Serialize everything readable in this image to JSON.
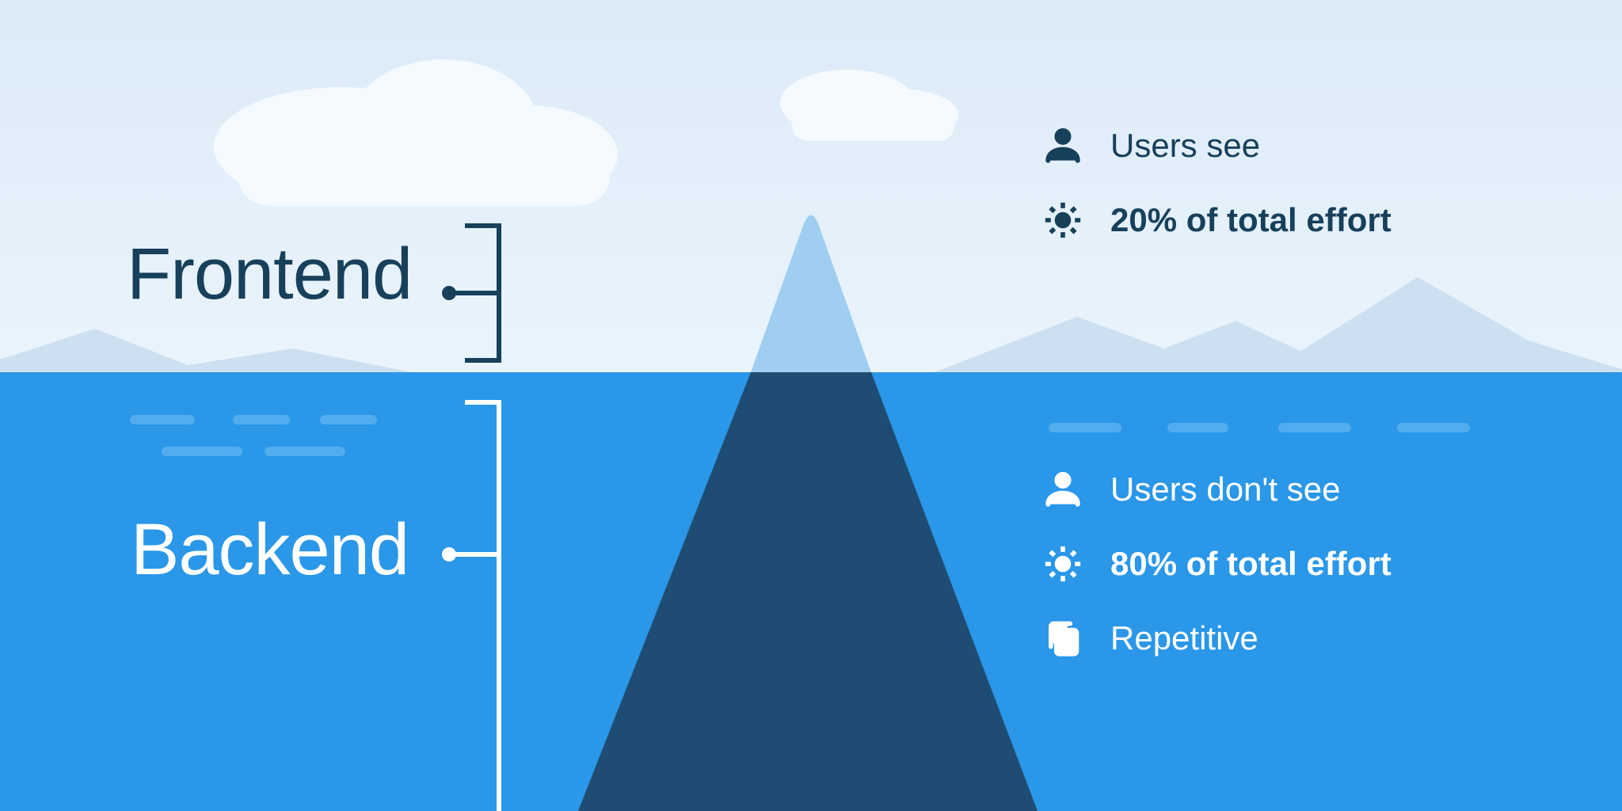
{
  "sections": {
    "frontend": {
      "label": "Frontend",
      "visibility": "Users see",
      "effort_pct": "20%",
      "effort_rest": " of total effort"
    },
    "backend": {
      "label": "Backend",
      "visibility": "Users don't see",
      "effort_pct": "80%",
      "effort_rest": " of total effort",
      "extra": "Repetitive"
    }
  },
  "colors": {
    "sky_top": "#dceaf8",
    "sky_bottom": "#e9f3fb",
    "cloud": "#f5fafe",
    "mountain": "#cde0f2",
    "water": "#2a97e8",
    "wave": "#49a6eb",
    "iceberg_top": "#9fcef1",
    "iceberg_bottom": "#1f4c72",
    "text_dark": "#17405b"
  }
}
